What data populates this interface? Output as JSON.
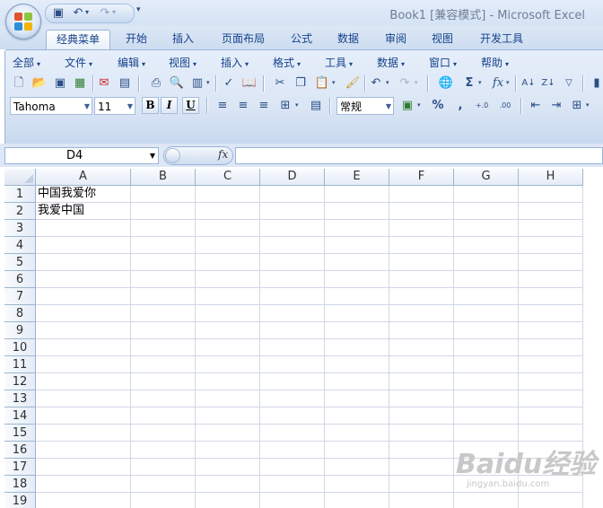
{
  "window": {
    "title": "Book1  [兼容模式] - Microsoft Excel"
  },
  "quick_access": {
    "buttons": [
      {
        "name": "save-icon",
        "glyph": "💾"
      },
      {
        "name": "undo-icon",
        "glyph": "↶"
      },
      {
        "name": "redo-icon",
        "glyph": "↷"
      }
    ],
    "customize_glyph": "▾"
  },
  "tabs": [
    {
      "label": "经典菜单",
      "active": true
    },
    {
      "label": "开始"
    },
    {
      "label": "插入"
    },
    {
      "label": "页面布局"
    },
    {
      "label": "公式"
    },
    {
      "label": "数据"
    },
    {
      "label": "审阅"
    },
    {
      "label": "视图"
    },
    {
      "label": "开发工具"
    }
  ],
  "menus": [
    "全部",
    "文件",
    "编辑",
    "视图",
    "插入",
    "格式",
    "工具",
    "数据",
    "窗口",
    "帮助"
  ],
  "toolbar": {
    "font_name": "Tahoma",
    "font_size": "11",
    "bold": "B",
    "italic": "I",
    "underline": "U",
    "number_format": "常规",
    "percent": "%",
    "comma": ",",
    "increase_decimal": "+.0",
    "decrease_decimal": ".00",
    "sigma": "Σ",
    "fx": "fx"
  },
  "formula_bar": {
    "name_box": "D4",
    "fx_label": "fx",
    "formula_value": ""
  },
  "sheet": {
    "columns": [
      "A",
      "B",
      "C",
      "D",
      "E",
      "F",
      "G",
      "H"
    ],
    "rows": [
      "1",
      "2",
      "3",
      "4",
      "5",
      "6",
      "7",
      "8",
      "9",
      "10",
      "11",
      "12",
      "13",
      "14",
      "15",
      "16",
      "17",
      "18",
      "19"
    ],
    "cells": {
      "A1": "中国我爱你",
      "A2": "我爱中国"
    }
  },
  "watermark": {
    "text": "Baidu经验",
    "sub": "jingyan.baidu.com"
  },
  "colors": {
    "accent": "#15428b",
    "ribbon": "#dbe6f5",
    "grid_line": "#d0d7e5"
  }
}
